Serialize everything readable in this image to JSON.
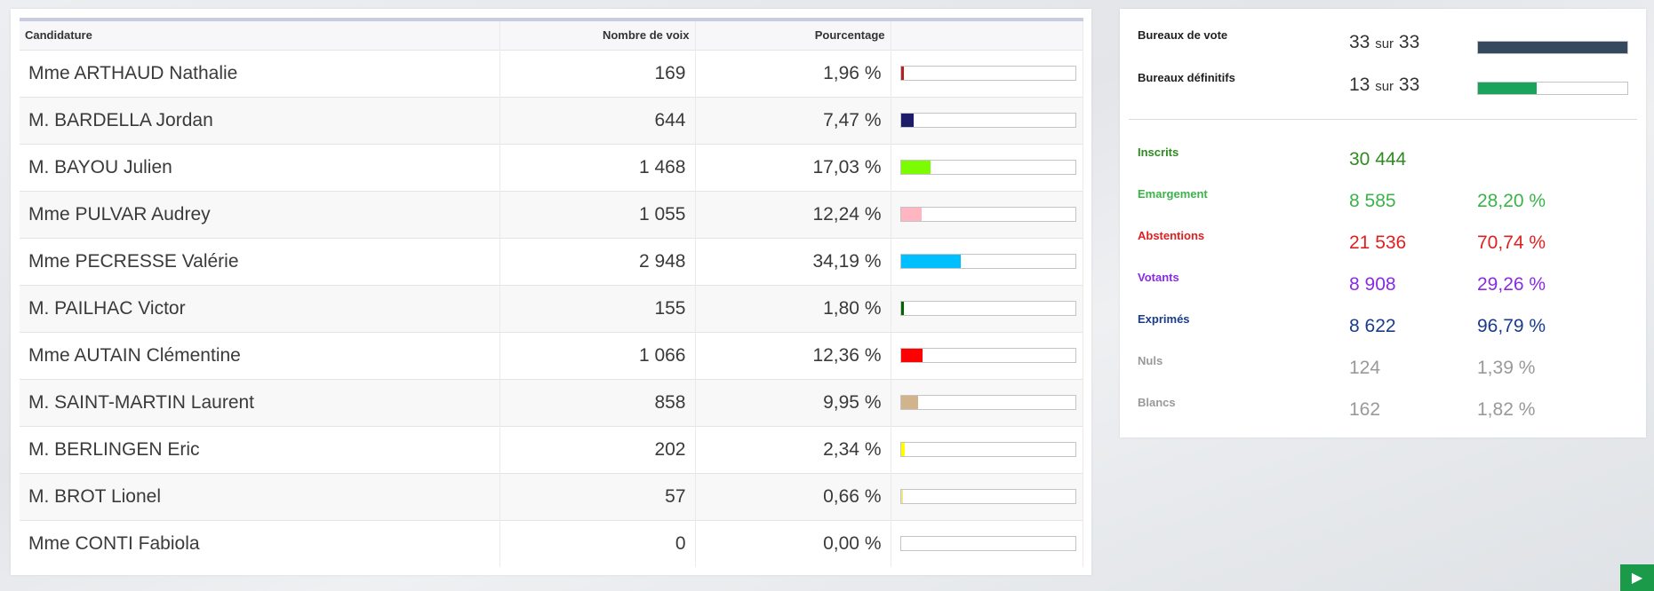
{
  "table": {
    "headers": [
      "Candidature",
      "Nombre de voix",
      "Pourcentage",
      ""
    ],
    "rows": [
      {
        "name": "Mme ARTHAUD Nathalie",
        "votes": "169",
        "pct": "1,96 %",
        "value": 1.96,
        "color": "#b22222"
      },
      {
        "name": "M. BARDELLA Jordan",
        "votes": "644",
        "pct": "7,47 %",
        "value": 7.47,
        "color": "#1c1c6b"
      },
      {
        "name": "M. BAYOU Julien",
        "votes": "1 468",
        "pct": "17,03 %",
        "value": 17.03,
        "color": "#7cfc00"
      },
      {
        "name": "Mme PULVAR Audrey",
        "votes": "1 055",
        "pct": "12,24 %",
        "value": 12.24,
        "color": "#ffb6c1"
      },
      {
        "name": "Mme PECRESSE Valérie",
        "votes": "2 948",
        "pct": "34,19 %",
        "value": 34.19,
        "color": "#00bfff"
      },
      {
        "name": "M. PAILHAC Victor",
        "votes": "155",
        "pct": "1,80 %",
        "value": 1.8,
        "color": "#006400"
      },
      {
        "name": "Mme AUTAIN Clémentine",
        "votes": "1 066",
        "pct": "12,36 %",
        "value": 12.36,
        "color": "#ff0000"
      },
      {
        "name": "M. SAINT-MARTIN Laurent",
        "votes": "858",
        "pct": "9,95 %",
        "value": 9.95,
        "color": "#d2b48c"
      },
      {
        "name": "M. BERLINGEN Eric",
        "votes": "202",
        "pct": "2,34 %",
        "value": 2.34,
        "color": "#ffff00"
      },
      {
        "name": "M. BROT Lionel",
        "votes": "57",
        "pct": "0,66 %",
        "value": 0.66,
        "color": "#f0e68c"
      },
      {
        "name": "Mme CONTI Fabiola",
        "votes": "0",
        "pct": "0,00 %",
        "value": 0.0,
        "color": "#cccccc"
      }
    ]
  },
  "summary": {
    "bureaux_vote": {
      "label": "Bureaux de vote",
      "count": "33",
      "sur": "sur",
      "total": "33",
      "fraction": 1.0,
      "color": "#34495e"
    },
    "bureaux_definitifs": {
      "label": "Bureaux définitifs",
      "count": "13",
      "sur": "sur",
      "total": "33",
      "fraction": 0.394,
      "color": "#1aa35a"
    },
    "stats": [
      {
        "label": "Inscrits",
        "value": "30 444",
        "pct": "",
        "color": "#2e8b1f"
      },
      {
        "label": "Emargement",
        "value": "8 585",
        "pct": "28,20 %",
        "color": "#3cb34a"
      },
      {
        "label": "Abstentions",
        "value": "21 536",
        "pct": "70,74 %",
        "color": "#e02020"
      },
      {
        "label": "Votants",
        "value": "8 908",
        "pct": "29,26 %",
        "color": "#8a2be2"
      },
      {
        "label": "Exprimés",
        "value": "8 622",
        "pct": "96,79 %",
        "color": "#1a3c8c"
      },
      {
        "label": "Nuls",
        "value": "124",
        "pct": "1,39 %",
        "color": "#999999"
      },
      {
        "label": "Blancs",
        "value": "162",
        "pct": "1,82 %",
        "color": "#999999"
      }
    ]
  },
  "icons": {
    "play": "play-icon"
  }
}
